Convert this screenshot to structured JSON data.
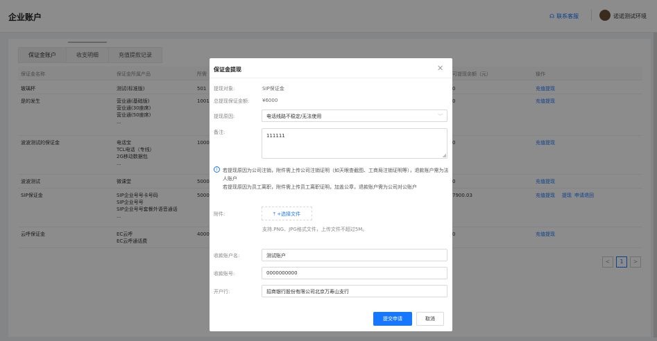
{
  "header": {
    "title": "企业账户",
    "contact_label": "联系客服",
    "user_name": "诺诺测试环境"
  },
  "tabs": [
    {
      "label": "保证金账户",
      "active": true
    },
    {
      "label": "收支明细",
      "active": false
    },
    {
      "label": "充值提款记录",
      "active": false
    }
  ],
  "table": {
    "columns": [
      "保证金名称",
      "保证金所属产品",
      "所需",
      "可提现余额（元）",
      "操作"
    ],
    "rows": [
      {
        "name": "玻璃杯",
        "products": [
          "测试(标准版)"
        ],
        "amount": "501",
        "balance": "0",
        "actions": [
          "充值提现"
        ]
      },
      {
        "name": "是的发生",
        "products": [
          "营业通(基础版)",
          "营业通(30座席)",
          "营业通(50座席)",
          "..."
        ],
        "amount": "1001",
        "balance": "0",
        "actions": [
          "充值提现"
        ]
      },
      {
        "name": "波波测试的保证金",
        "products": [
          "电话宝",
          "TCL电话（专线）",
          "2G移动数据包",
          "..."
        ],
        "amount": "1000",
        "balance": "0",
        "actions": [
          "充值提现"
        ]
      },
      {
        "name": "波波测试",
        "products": [
          "微课堂"
        ],
        "amount": "5000",
        "balance": "0",
        "actions": [
          "充值提现"
        ]
      },
      {
        "name": "SIP保证金",
        "products": [
          "SIP企业号号卡号码",
          "SIP企业号号",
          "SIP企业号号套餐外语音通话",
          "..."
        ],
        "amount": "5000",
        "balance": "7900.03",
        "actions": [
          "充值提现",
          "提现",
          "申请退回"
        ]
      },
      {
        "name": "云呼保证金",
        "products": [
          "EC云呼",
          "EC云呼通话费"
        ],
        "amount": "4000",
        "balance": "0",
        "actions": [
          "充值提现"
        ]
      }
    ]
  },
  "pager": {
    "current": "1",
    "prev": "<",
    "next": ">"
  },
  "modal": {
    "title": "保证金提现",
    "fields": {
      "target_label": "提现对象:",
      "target_value": "SIP保证金",
      "total_label": "总提现保证金额:",
      "total_value": "¥6000",
      "reason_label": "提现原因:",
      "reason_value": "电话线路不稳定/无法使用",
      "remark_label": "备注:",
      "remark_value": "111111",
      "attachment_label": "附件:",
      "upload_label": "+选择文件",
      "upload_hint": "支持.PNG、JPG格式文件，上传文件不超过5M。",
      "account_name_label": "收款账户名:",
      "account_name_value": "测试账户",
      "account_no_label": "收款账号:",
      "account_no_value": "0000000000",
      "bank_label": "开户行:",
      "bank_value": "招商银行股份有限公司北京万寿山支行"
    },
    "notice": [
      "若提现原因为公司注销，附件需上传公司注销证明（如天眼查截图、工商局注销证明等），退款账户需为法人账户",
      "若提现原因为员工离职，附件需上传员工离职证明，加盖公章，退款账户需为公司对公账户"
    ],
    "submit_label": "提交申请",
    "cancel_label": "取消"
  }
}
